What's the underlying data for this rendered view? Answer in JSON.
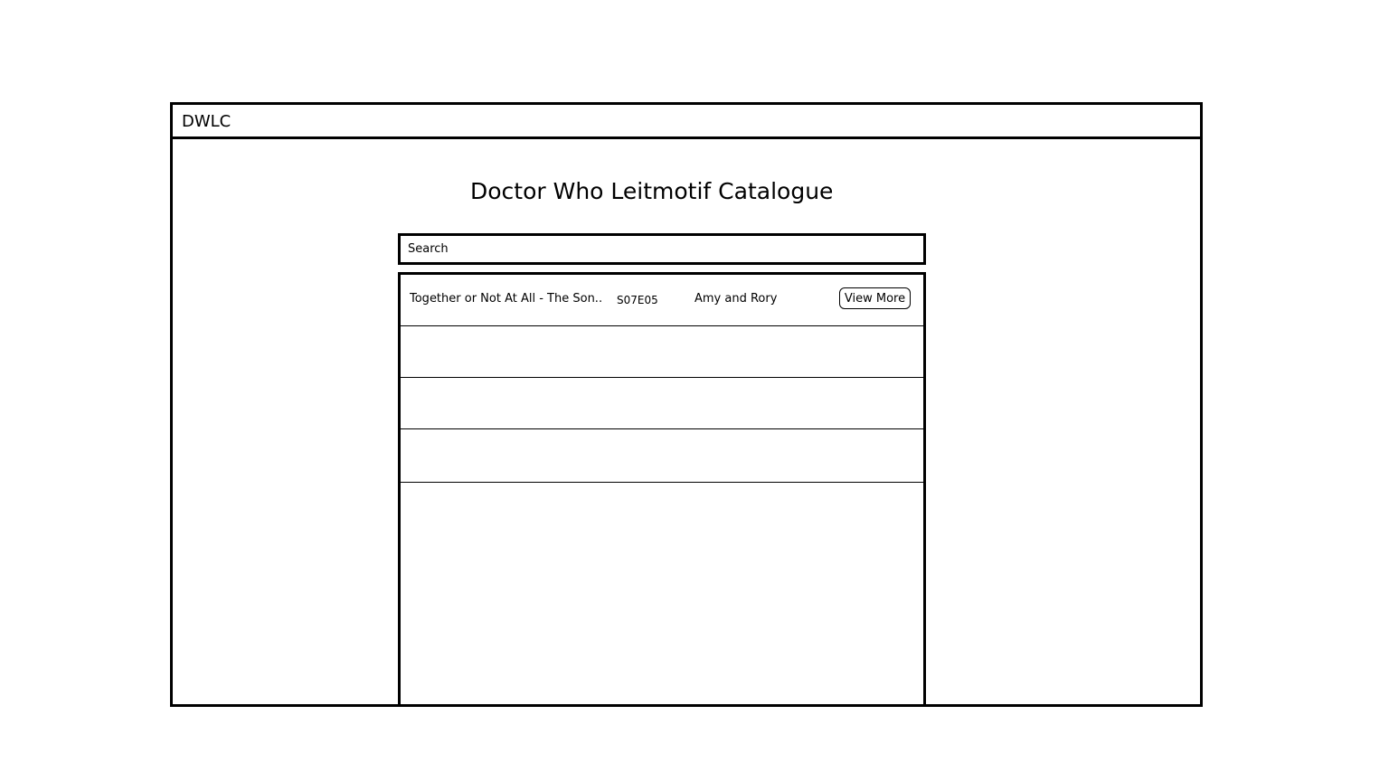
{
  "app": {
    "name": "DWLC"
  },
  "page": {
    "title": "Doctor Who Leitmotif Catalogue"
  },
  "search": {
    "placeholder": "Search",
    "value": ""
  },
  "results": {
    "rows": [
      {
        "title": "Together or Not At All - The Son...",
        "episode": "S07E05",
        "characters": "Amy and Rory",
        "action_label": "View More"
      },
      {
        "title": "",
        "episode": "",
        "characters": "",
        "action_label": ""
      },
      {
        "title": "",
        "episode": "",
        "characters": "",
        "action_label": ""
      },
      {
        "title": "",
        "episode": "",
        "characters": "",
        "action_label": ""
      }
    ]
  }
}
